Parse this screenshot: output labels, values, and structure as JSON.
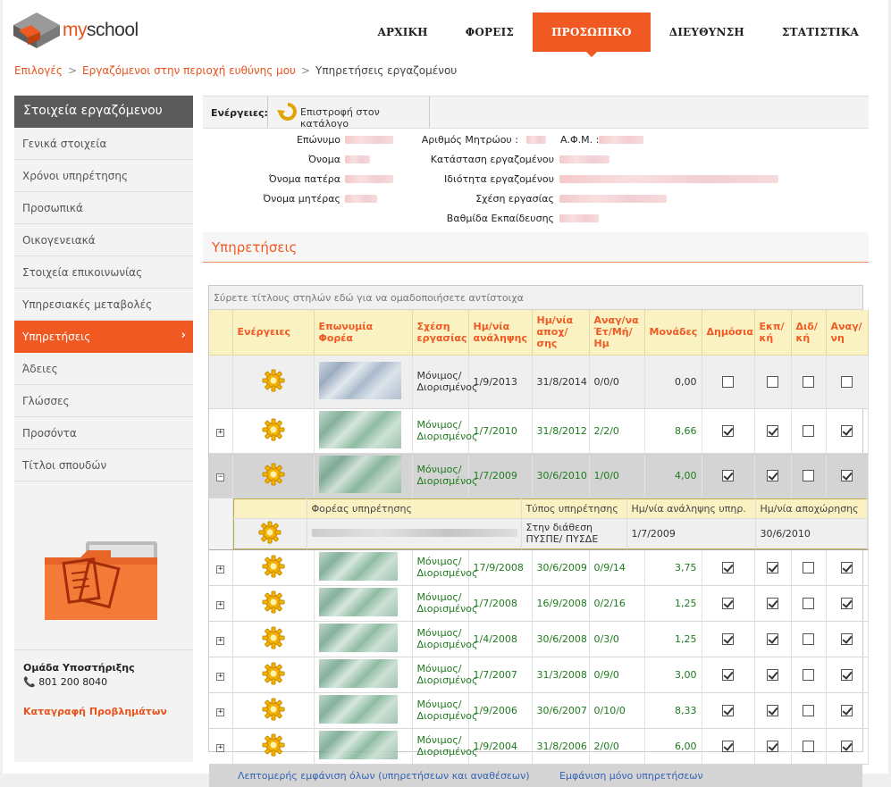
{
  "brand": {
    "name": "myschool",
    "name_prefix": "my",
    "name_suffix": "school"
  },
  "nav": {
    "items": [
      "ΑΡΧΙΚΗ",
      "ΦΟΡΕΙΣ",
      "ΠΡΟΣΩΠΙΚΟ",
      "ΔΙΕΥΘΥΝΣΗ",
      "ΣΤΑΤΙΣΤΙΚΑ"
    ],
    "active": "ΠΡΟΣΩΠΙΚΟ"
  },
  "breadcrumb": {
    "items": [
      "Επιλογές",
      "Εργαζόμενοι στην περιοχή ευθύνης μου",
      "Υπηρετήσεις εργαζομένου"
    ],
    "sep": ">"
  },
  "sidebar": {
    "title": "Στοιχεία εργαζόμενου",
    "items": [
      "Γενικά στοιχεία",
      "Χρόνοι υπηρέτησης",
      "Προσωπικά",
      "Οικογενειακά",
      "Στοιχεία επικοινωνίας",
      "Υπηρεσιακές μεταβολές",
      "Υπηρετήσεις",
      "Άδειες",
      "Γλώσσες",
      "Προσόντα",
      "Τίτλοι σπουδών"
    ],
    "active": "Υπηρετήσεις",
    "chevron": "›"
  },
  "support": {
    "title": "Ομάδα Υποστήριξης",
    "phone_icon": "phone-icon",
    "phone": "801 200 8040",
    "report_link": "Καταγραφή Προβλημάτων"
  },
  "actions": {
    "label": "Ενέργειες:",
    "return_label": "Επιστροφή στον κατάλογο"
  },
  "employee": {
    "labels_left": [
      "Επώνυμο",
      "Όνομα",
      "Όνομα πατέρα",
      "Όνομα μητέρας"
    ],
    "labels_right": [
      "Αριθμός Μητρώου :",
      "Κατάσταση εργαζομένου",
      "Ιδιότητα εργαζομένου",
      "Σχέση εργασίας",
      "Βαθμίδα Εκπαίδευσης"
    ],
    "label_afm": "Α.Φ.Μ. :"
  },
  "services_title": "Υπηρετήσεις",
  "grid": {
    "group_hint": "Σύρετε τίτλους στηλών εδώ για να ομαδοποιήσετε αντίστοιχα",
    "columns": [
      "Ενέργειες",
      "Επωνυμία Φορέα",
      "Σχέση εργασίας",
      "Ημ/νία ανάληψης",
      "Ημ/νία αποχ/σης",
      "Αναγ/να Έτ/Μή/Ημ",
      "Μονάδες",
      "Δημόσια",
      "Εκπ/κή",
      "Διδ/κή",
      "Αναγ/νη"
    ],
    "rows": [
      {
        "expander": "",
        "relation": "Μόνιμος/Διορισμένος",
        "start": "1/9/2013",
        "end": "31/8/2014",
        "recognized": "0/0/0",
        "units": "0,00",
        "checks": [
          false,
          false,
          false,
          false
        ]
      },
      {
        "expander": "+",
        "relation": "Μόνιμος/Διορισμένος",
        "start": "1/7/2010",
        "end": "31/8/2012",
        "recognized": "2/2/0",
        "units": "8,66",
        "checks": [
          true,
          true,
          false,
          true
        ]
      },
      {
        "expander": "−",
        "relation": "Μόνιμος/Διορισμένος",
        "start": "1/7/2009",
        "end": "30/6/2010",
        "recognized": "1/0/0",
        "units": "4,00",
        "checks": [
          true,
          true,
          false,
          true
        ]
      },
      {
        "expander": "+",
        "relation": "Μόνιμος/Διορισμένος",
        "start": "17/9/2008",
        "end": "30/6/2009",
        "recognized": "0/9/14",
        "units": "3,75",
        "checks": [
          true,
          true,
          false,
          true
        ]
      },
      {
        "expander": "+",
        "relation": "Μόνιμος/Διορισμένος",
        "start": "1/7/2008",
        "end": "16/9/2008",
        "recognized": "0/2/16",
        "units": "1,25",
        "checks": [
          true,
          true,
          false,
          true
        ]
      },
      {
        "expander": "+",
        "relation": "Μόνιμος/Διορισμένος",
        "start": "1/4/2008",
        "end": "30/6/2008",
        "recognized": "0/3/0",
        "units": "1,25",
        "checks": [
          true,
          true,
          false,
          true
        ]
      },
      {
        "expander": "+",
        "relation": "Μόνιμος/Διορισμένος",
        "start": "1/7/2007",
        "end": "31/3/2008",
        "recognized": "0/9/0",
        "units": "3,00",
        "checks": [
          true,
          true,
          false,
          true
        ]
      },
      {
        "expander": "+",
        "relation": "Μόνιμος/Διορισμένος",
        "start": "1/9/2006",
        "end": "30/6/2007",
        "recognized": "0/10/0",
        "units": "8,33",
        "checks": [
          true,
          true,
          false,
          true
        ]
      },
      {
        "expander": "+",
        "relation": "Μόνιμος/Διορισμένος",
        "start": "1/9/2004",
        "end": "31/8/2006",
        "recognized": "2/0/0",
        "units": "6,00",
        "checks": [
          true,
          true,
          false,
          true
        ]
      }
    ],
    "detail": {
      "columns": [
        "Φορέας υπηρέτησης",
        "Τύπος υπηρέτησης",
        "Ημ/νία ανάληψης υπηρ.",
        "Ημ/νία αποχώρησης"
      ],
      "row": {
        "type": "Στην διάθεση ΠΥΣΠΕ/ ΠΥΣΔΕ",
        "start": "1/7/2009",
        "end": "30/6/2010"
      }
    },
    "footer_links": [
      "Λεπτομερής εμφάνιση όλων (υπηρετήσεων και αναθέσεων)",
      "Εμφάνιση μόνο υπηρετήσεων"
    ]
  },
  "colors": {
    "accent": "#f05a22",
    "header_row": "#fbf2c4",
    "sidebar_title": "#5a5a5a"
  }
}
